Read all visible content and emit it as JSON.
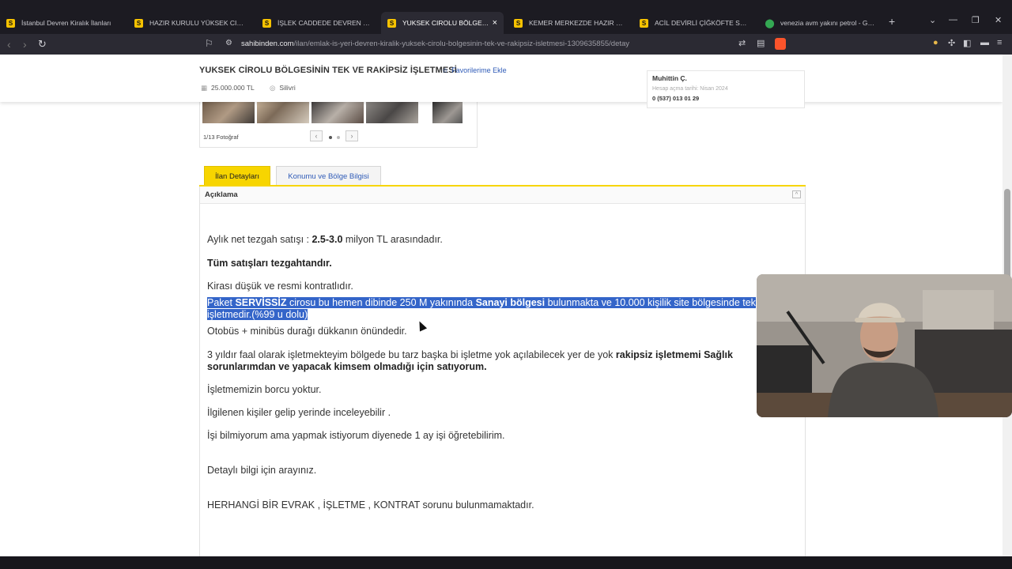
{
  "browser": {
    "tabs": [
      {
        "title": "İstanbul Devren Kiralık İlanları",
        "favicon": "S",
        "active": false
      },
      {
        "title": "HAZIR KURULU YÜKSEK CIROLU DÖNER",
        "favicon": "S",
        "active": false
      },
      {
        "title": "İŞLEK CADDEDE DEVREN KİRALIK KAFE",
        "favicon": "S",
        "active": false
      },
      {
        "title": "YUKSEK CIROLU BÖLGESININ TEK VE",
        "favicon": "S",
        "active": true
      },
      {
        "title": "KEMER MERKEZDE HAZIR KURULU CAFE",
        "favicon": "S",
        "active": false
      },
      {
        "title": "ACİL DEVİRLİ ÇİĞKÖFTE SALONU - D",
        "favicon": "S",
        "active": false
      },
      {
        "title": "venezia avm yakını petrol - Google M",
        "favicon": "map-pin",
        "active": false
      }
    ],
    "tab_close_glyph": "×",
    "new_tab_glyph": "+",
    "url_domain": "sahibinden.com",
    "url_path": "/ilan/emlak-is-yeri-devren-kiralik-yuksek-cirolu-bolgesinin-tek-ve-rakipsiz-isletmesi-1309635855/detay"
  },
  "listing": {
    "title": "YUKSEK CİROLU BÖLGESİNİN TEK VE RAKİPSİZ İŞLETMESİ",
    "favorite_label": "Favorilerime Ekle",
    "price": "25.000.000 TL",
    "location": "Silivri"
  },
  "seller": {
    "name": "Muhittin Ç.",
    "account_date": "Hesap açma tarihi: Nisan 2024",
    "phone": "0 (537) 013 01 29"
  },
  "gallery": {
    "photo_count": "1/13 Fotoğraf",
    "prev_glyph": "‹",
    "next_glyph": "›"
  },
  "tabs": {
    "details": "İlan Detayları",
    "location": "Konumu ve Bölge Bilgisi"
  },
  "description": {
    "heading": "Açıklama",
    "collapse_glyph": "^",
    "l1_a": "Aylık net tezgah satışı : ",
    "l1_b": "2.5-3.0",
    "l1_c": " milyon TL arasındadır.",
    "l2": "Tüm satışları tezgahtandır.",
    "l3": "Kirası düşük ve resmi kontratlıdır.",
    "l4_a": "Paket ",
    "l4_b": "SERVİSSİZ",
    "l4_c": " cirosu bu hemen dibinde 250 M yakınında ",
    "l4_d": "Sanayi bölgesi",
    "l4_e": " bulunmakta ve 10.000 kişilik site bölgesinde tek",
    "l5": "işletmedir.(%99 u dolu)",
    "l6": "Otobüs + minibüs durağı dükkanın önündedir.",
    "l7_a": "3 yıldır faal olarak işletmekteyim bölgede bu tarz başka bi işletme yok açılabilecek yer de yok ",
    "l7_b": "rakipsiz işletmemi Sağlık",
    "l8": "sorunlarımdan ve yapacak kimsem olmadığı için satıyorum.",
    "l9": "İşletmemizin borcu yoktur.",
    "l10": "İlgilenen kişiler gelip yerinde inceleyebilir .",
    "l11": "İşi bilmiyorum ama yapmak istiyorum diyenede 1 ay işi öğretebilirim.",
    "l12": "Detaylı bilgi için arayınız.",
    "l13": "HERHANGİ BİR EVRAK , İŞLETME , KONTRAT sorunu bulunmamaktadır."
  },
  "colors": {
    "accent_yellow": "#f7d500",
    "link_blue": "#2f5bb7",
    "selection": "#3465c9"
  }
}
